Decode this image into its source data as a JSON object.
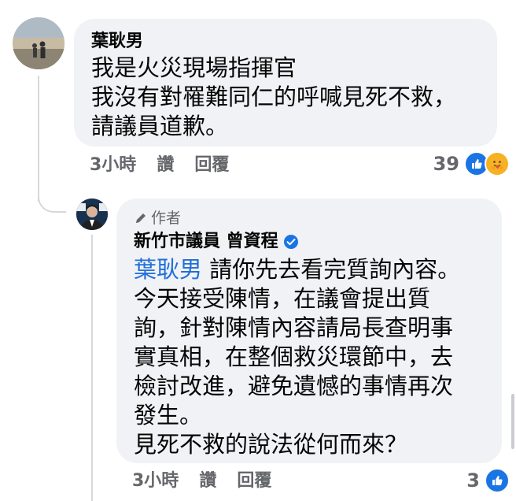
{
  "comment_1": {
    "author": "葉耿男",
    "text": "我是火災現場指揮官\n我沒有對罹難同仁的呼喊見死不救，\n請議員道歉。",
    "time": "3小時",
    "like_label": "讚",
    "reply_label": "回覆",
    "reaction_count": "39",
    "reactions": [
      "like-icon",
      "care-icon"
    ]
  },
  "comment_2": {
    "badge_label": "作者",
    "author": "新竹市議員 曾資程",
    "verified": true,
    "mention": "葉耿男",
    "text_after_mention": " 請你先去看完質詢內容。\n今天接受陳情，在議會提出質\n詢，針對陳情內容請局長查明事\n實真相，在整個救災環節中，去\n檢討改進，避免遺憾的事情再次\n發生。\n見死不救的說法從何而來？",
    "time": "3小時",
    "like_label": "讚",
    "reply_label": "回覆",
    "reaction_count": "3",
    "reactions": [
      "like-icon"
    ]
  },
  "colors": {
    "bubble": "#f0f2f5",
    "mention": "#216fdb",
    "meta": "#65676b",
    "like": "#1b74e4",
    "verified": "#1b74e4"
  }
}
